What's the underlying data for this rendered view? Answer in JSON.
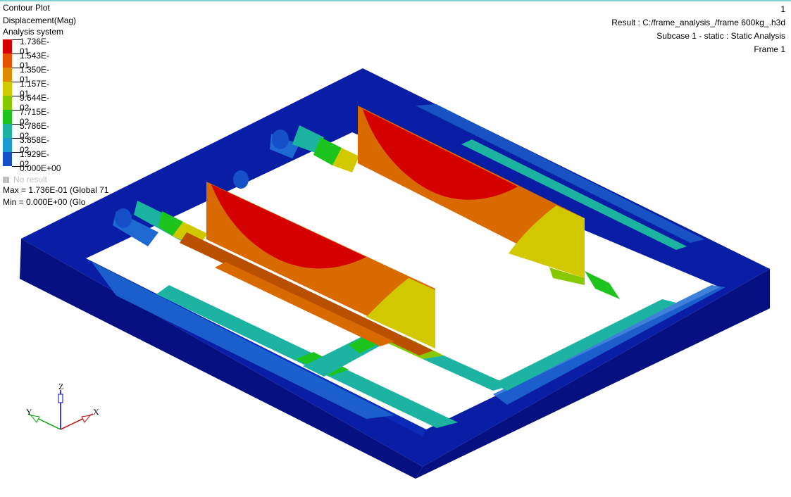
{
  "header": {
    "plot_type": "Contour Plot",
    "result_type": "Displacement(Mag)",
    "system": "Analysis system"
  },
  "legend": {
    "levels": [
      {
        "label": "1.736E-01",
        "color": "#d40000"
      },
      {
        "label": "1.543E-01",
        "color": "#e85000"
      },
      {
        "label": "1.350E-01",
        "color": "#e08a00"
      },
      {
        "label": "1.157E-01",
        "color": "#d2c800"
      },
      {
        "label": "9.644E-02",
        "color": "#88c800"
      },
      {
        "label": "7.715E-02",
        "color": "#1ec41e"
      },
      {
        "label": "5.786E-02",
        "color": "#1cb4a0"
      },
      {
        "label": "3.858E-02",
        "color": "#1e9ad2"
      },
      {
        "label": "1.929E-02",
        "color": "#1550c8"
      },
      {
        "label": "0.000E+00",
        "color": "#0a0fa0"
      }
    ],
    "no_result": "No result",
    "max_text": "Max = 1.736E-01 (Global 71",
    "min_text": "Min = 0.000E+00 (Glo",
    "max_tail": "",
    "min_tail": ""
  },
  "info": {
    "page_number": "1",
    "result": "Result : C:/frame_analysis_/frame 600kg_.h3d",
    "subcase": "Subcase 1 - static : Static Analysis",
    "frame": "Frame 1"
  },
  "triad": {
    "x_label": "X",
    "y_label": "Y",
    "z_label": "Z",
    "x_color": "#c00000",
    "y_color": "#00a000",
    "z_color": "#0000c0"
  },
  "colors": {
    "frame_dark": "#0a1ea5",
    "frame_side": "#061080",
    "beam_blue": "#1e6ad2",
    "beam_teal": "#1cb4a0",
    "beam_green": "#1ec41e",
    "plate_red": "#d40000",
    "plate_orange": "#d86a00",
    "plate_yellow": "#d2c800"
  }
}
